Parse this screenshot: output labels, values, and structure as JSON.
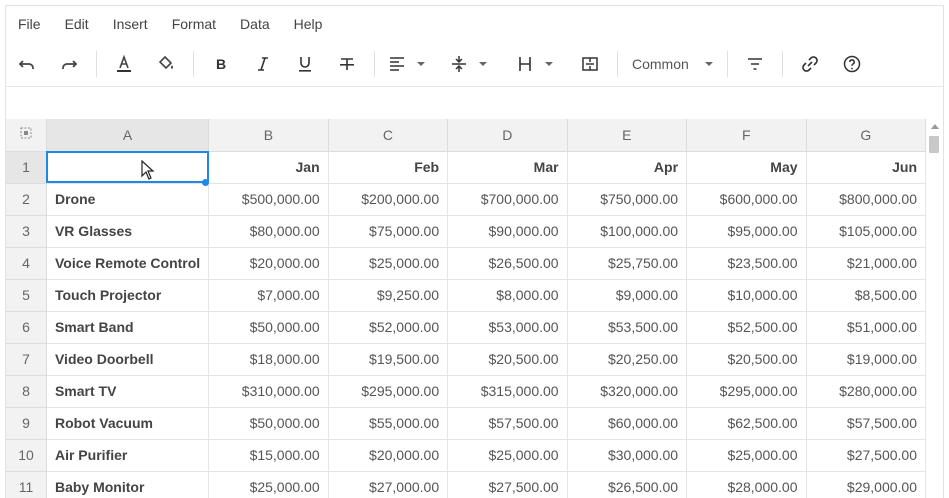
{
  "menu": [
    "File",
    "Edit",
    "Insert",
    "Format",
    "Data",
    "Help"
  ],
  "toolbar": {
    "number_format": "Common",
    "icons": [
      "undo-icon",
      "redo-icon",
      "text-color-icon",
      "fill-color-icon",
      "bold-icon",
      "italic-icon",
      "underline-icon",
      "strikethrough-icon",
      "align-left-icon",
      "vertical-align-icon",
      "borders-icon",
      "merge-cells-icon",
      "filter-icon",
      "link-icon",
      "help-icon"
    ]
  },
  "grid": {
    "columns": [
      "A",
      "B",
      "C",
      "D",
      "E",
      "F",
      "G"
    ],
    "active_column": "A",
    "active_row": "1",
    "rows": [
      {
        "num": "1",
        "cells": [
          "",
          "Jan",
          "Feb",
          "Mar",
          "Apr",
          "May",
          "Jun"
        ]
      },
      {
        "num": "2",
        "cells": [
          "Drone",
          "$500,000.00",
          "$200,000.00",
          "$700,000.00",
          "$750,000.00",
          "$600,000.00",
          "$800,000.00"
        ]
      },
      {
        "num": "3",
        "cells": [
          "VR Glasses",
          "$80,000.00",
          "$75,000.00",
          "$90,000.00",
          "$100,000.00",
          "$95,000.00",
          "$105,000.00"
        ]
      },
      {
        "num": "4",
        "cells": [
          "Voice Remote Control",
          "$20,000.00",
          "$25,000.00",
          "$26,500.00",
          "$25,750.00",
          "$23,500.00",
          "$21,000.00"
        ]
      },
      {
        "num": "5",
        "cells": [
          "Touch Projector",
          "$7,000.00",
          "$9,250.00",
          "$8,000.00",
          "$9,000.00",
          "$10,000.00",
          "$8,500.00"
        ]
      },
      {
        "num": "6",
        "cells": [
          "Smart Band",
          "$50,000.00",
          "$52,000.00",
          "$53,000.00",
          "$53,500.00",
          "$52,500.00",
          "$51,000.00"
        ]
      },
      {
        "num": "7",
        "cells": [
          "Video Doorbell",
          "$18,000.00",
          "$19,500.00",
          "$20,500.00",
          "$20,250.00",
          "$20,500.00",
          "$19,000.00"
        ]
      },
      {
        "num": "8",
        "cells": [
          "Smart TV",
          "$310,000.00",
          "$295,000.00",
          "$315,000.00",
          "$320,000.00",
          "$295,000.00",
          "$280,000.00"
        ]
      },
      {
        "num": "9",
        "cells": [
          "Robot Vacuum",
          "$50,000.00",
          "$55,000.00",
          "$57,500.00",
          "$60,000.00",
          "$62,500.00",
          "$57,500.00"
        ]
      },
      {
        "num": "10",
        "cells": [
          "Air Purifier",
          "$15,000.00",
          "$20,000.00",
          "$25,000.00",
          "$30,000.00",
          "$25,000.00",
          "$27,500.00"
        ]
      },
      {
        "num": "11",
        "cells": [
          "Baby Monitor",
          "$25,000.00",
          "$27,000.00",
          "$27,500.00",
          "$26,500.00",
          "$28,000.00",
          "$29,000.00"
        ]
      }
    ]
  },
  "colors": {
    "accent": "#1e88e5",
    "header_bg": "#f2f2f2",
    "grid_line": "#e4e4e4"
  }
}
